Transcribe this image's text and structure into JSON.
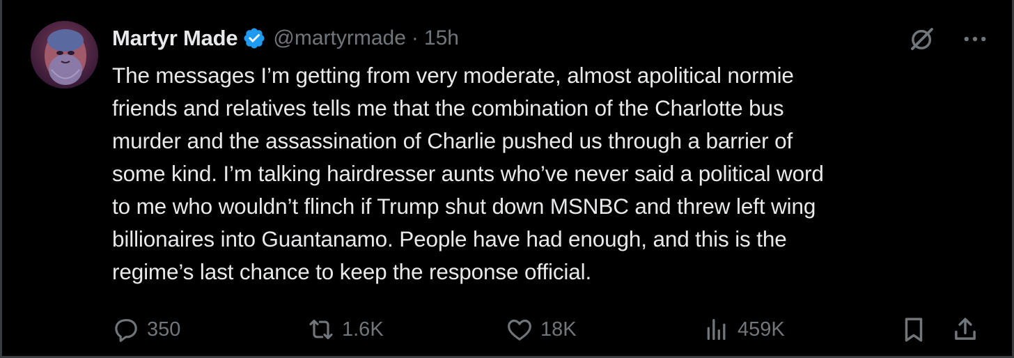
{
  "author": {
    "name": "Martyr Made",
    "handle": "@martyrmade",
    "separator": "·",
    "time": "15h",
    "verified": true
  },
  "body_lines": [
    "The messages I’m getting from very moderate, almost apolitical normie",
    "friends and relatives tells me that the combination of the Charlotte bus",
    "murder and the assassination of Charlie pushed us through a barrier of",
    "some kind. I’m talking hairdresser aunts who’ve never said a political word",
    "to me who wouldn’t flinch if Trump shut down MSNBC and threw left wing",
    "billionaires into Guantanamo. People have had enough, and this is the",
    "regime’s last chance to keep the response official."
  ],
  "actions": {
    "replies": "350",
    "reposts": "1.6K",
    "likes": "18K",
    "views": "459K"
  },
  "icons": {
    "avatar": "avatar",
    "verified": "verified-badge-icon",
    "grok": "grok-icon",
    "more": "more-icon",
    "reply": "reply-icon",
    "repost": "repost-icon",
    "like": "like-icon",
    "views": "views-icon",
    "bookmark": "bookmark-icon",
    "share": "share-icon"
  },
  "colors": {
    "background": "#000000",
    "text": "#e7e9ea",
    "muted": "#71767b",
    "verified": "#1d9bf0"
  }
}
